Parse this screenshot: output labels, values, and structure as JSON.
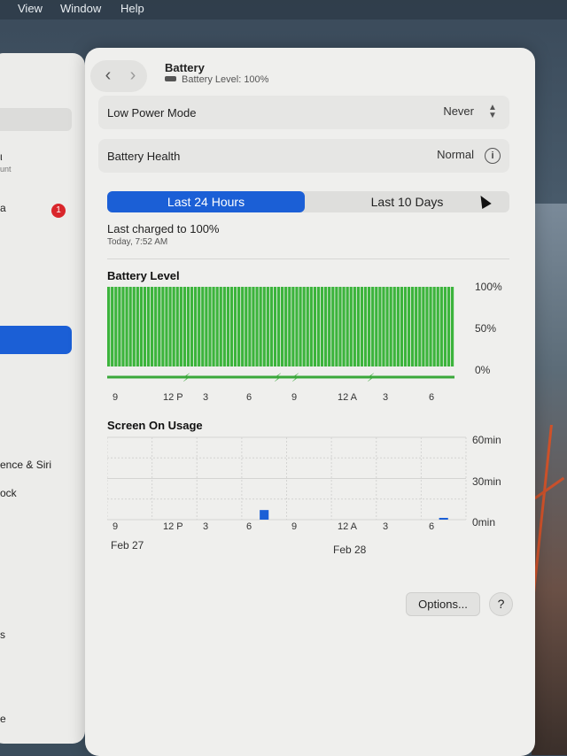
{
  "menubar": {
    "items": [
      "View",
      "Window",
      "Help"
    ]
  },
  "sidebar": {
    "texts": [
      "ι",
      "unt",
      "a",
      "ence & Siri",
      "ock",
      "s",
      "e"
    ],
    "badge": "1"
  },
  "header": {
    "back_icon": "chevron-left-icon",
    "forward_icon": "chevron-right-icon",
    "title": "Battery",
    "subtitle": "Battery Level: 100%"
  },
  "rows": {
    "low_power": {
      "label": "Low Power Mode",
      "value": "Never"
    },
    "health": {
      "label": "Battery Health",
      "value": "Normal"
    }
  },
  "segments": {
    "active": "Last 24 Hours",
    "inactive": "Last 10 Days"
  },
  "charged": {
    "title": "Last charged to 100%",
    "time": "Today, 7:52 AM"
  },
  "colors": {
    "accent": "#1b5fd6",
    "battery_green": "#3cb43c",
    "usage_blue": "#1b5fd6"
  },
  "chart_data": [
    {
      "type": "bar",
      "title": "Battery Level",
      "y_ticks": [
        "100%",
        "50%",
        "0%"
      ],
      "ylim": [
        0,
        100
      ],
      "x_tick_labels": [
        "9",
        "12 P",
        "3",
        "6",
        "9",
        "12 A",
        "3",
        "6"
      ],
      "values": [
        100,
        100,
        100,
        100,
        100,
        100,
        100,
        100,
        100,
        100,
        100,
        100,
        100,
        100,
        100,
        100,
        100,
        100,
        100,
        100,
        100,
        100,
        100,
        100,
        100,
        100,
        100,
        100,
        100,
        100,
        100,
        100,
        100,
        100,
        100,
        100,
        100,
        100,
        100,
        100,
        100,
        100,
        100,
        100,
        100,
        100,
        100,
        100,
        100,
        100,
        100,
        100,
        100,
        100,
        100,
        100,
        100,
        100,
        100,
        100,
        100,
        100,
        100,
        100,
        100,
        100,
        100,
        100,
        100,
        100,
        100,
        100,
        100,
        100,
        100,
        100,
        100,
        100,
        100,
        100,
        100,
        100,
        100,
        100,
        100,
        100,
        100,
        100,
        100,
        100,
        100,
        100,
        100,
        100,
        100,
        100
      ],
      "charging_markers": [
        "⚡",
        "⚡",
        "⚡",
        "⚡"
      ]
    },
    {
      "type": "bar",
      "title": "Screen On Usage",
      "y_ticks": [
        "60min",
        "30min",
        "0min"
      ],
      "ylim": [
        0,
        60
      ],
      "x_tick_labels": [
        "9",
        "12 P",
        "3",
        "6",
        "9",
        "12 A",
        "3",
        "6"
      ],
      "dates": [
        "Feb 27",
        "Feb 28"
      ],
      "hours": 24,
      "values": [
        0,
        0,
        0,
        0,
        0,
        0,
        0,
        0,
        0,
        0,
        7,
        0,
        0,
        0,
        0,
        0,
        0,
        0,
        0,
        0,
        0,
        0,
        1,
        0
      ]
    }
  ],
  "footer": {
    "options_label": "Options...",
    "help_label": "?"
  }
}
